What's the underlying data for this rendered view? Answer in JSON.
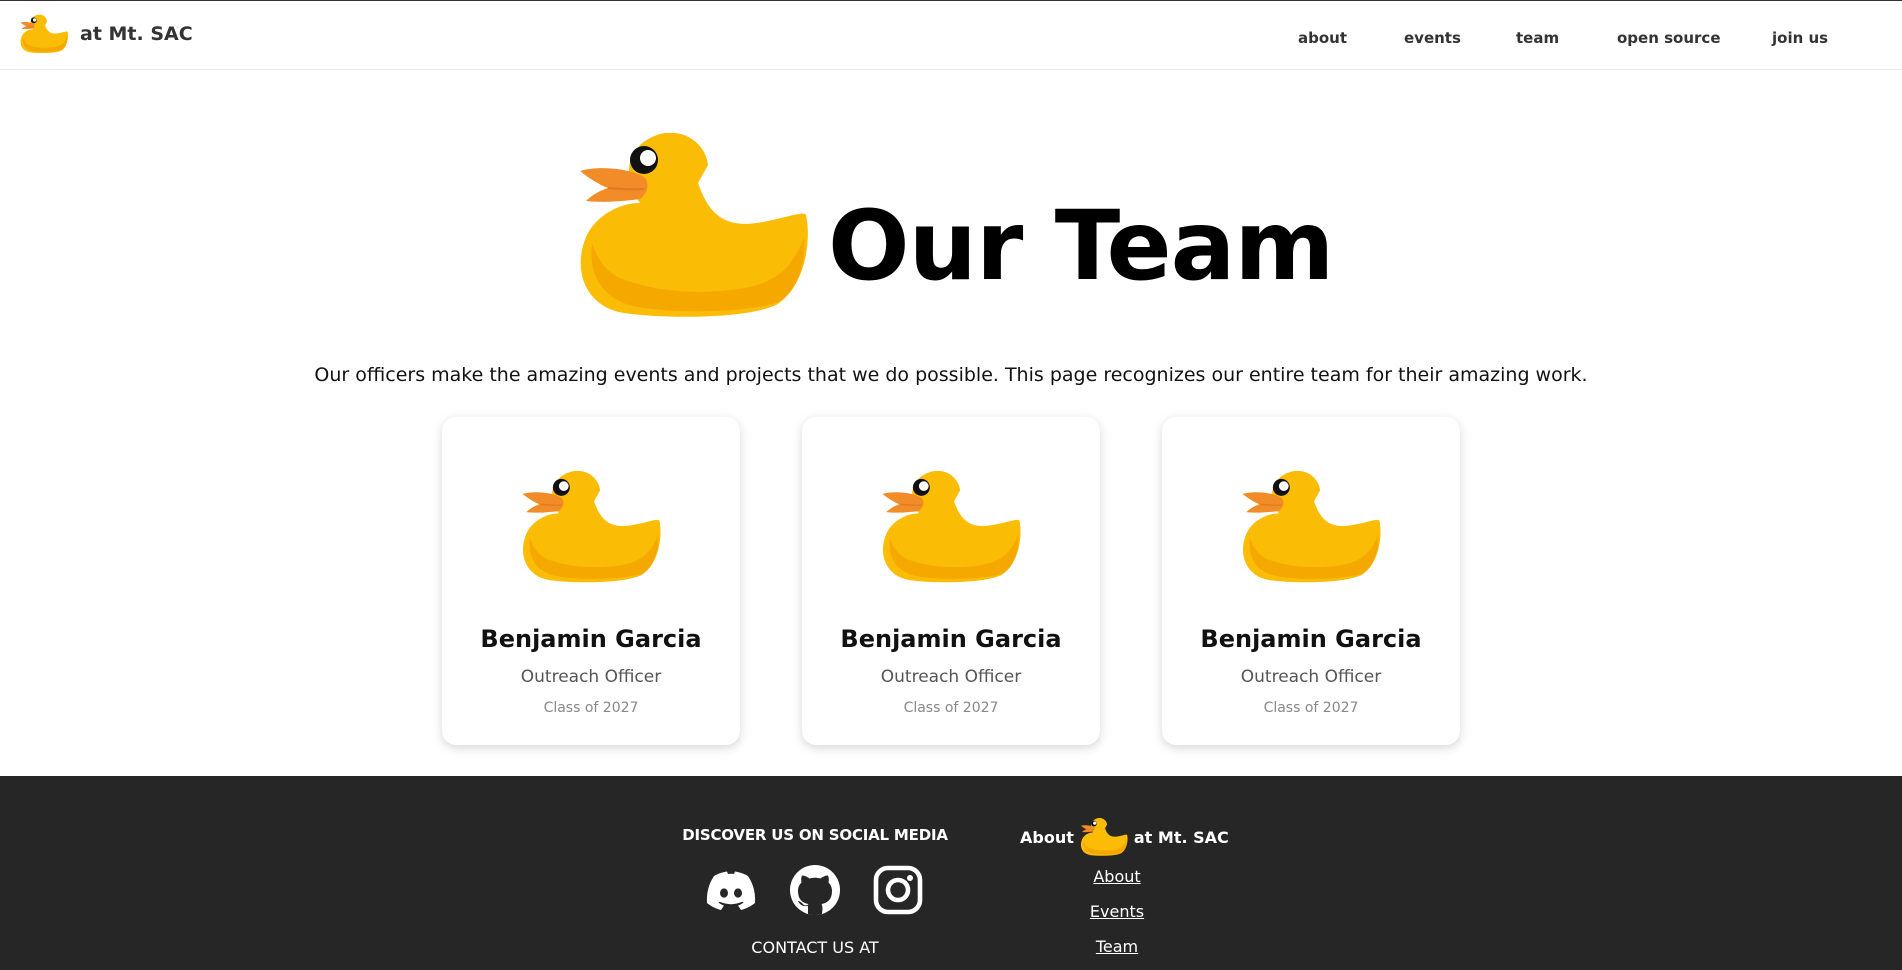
{
  "colors": {
    "duck_body": "#FBBC05",
    "duck_shadow": "#F5A900",
    "duck_beak": "#F28C28",
    "footer_bg": "#262626"
  },
  "nav": {
    "brand_logo": "rubber-duck-logo",
    "brand_text": "at Mt. SAC",
    "links": [
      "about",
      "events",
      "team",
      "open source",
      "join us"
    ]
  },
  "hero": {
    "logo": "rubber-duck-logo",
    "title": "Our Team",
    "intro": "Our officers make the amazing events and projects that we do possible. This page recognizes our entire team for their amazing work."
  },
  "team": [
    {
      "avatar": "rubber-duck-avatar",
      "name": "Benjamin Garcia",
      "role": "Outreach Officer",
      "class": "Class of 2027"
    },
    {
      "avatar": "rubber-duck-avatar",
      "name": "Benjamin Garcia",
      "role": "Outreach Officer",
      "class": "Class of 2027"
    },
    {
      "avatar": "rubber-duck-avatar",
      "name": "Benjamin Garcia",
      "role": "Outreach Officer",
      "class": "Class of 2027"
    }
  ],
  "footer": {
    "social_heading": "DISCOVER US ON SOCIAL MEDIA",
    "social_icons": [
      "discord-icon",
      "github-icon",
      "instagram-icon"
    ],
    "contact": "CONTACT US AT",
    "about_prefix": "About",
    "about_suffix": "at Mt. SAC",
    "links": [
      "About",
      "Events",
      "Team"
    ]
  }
}
